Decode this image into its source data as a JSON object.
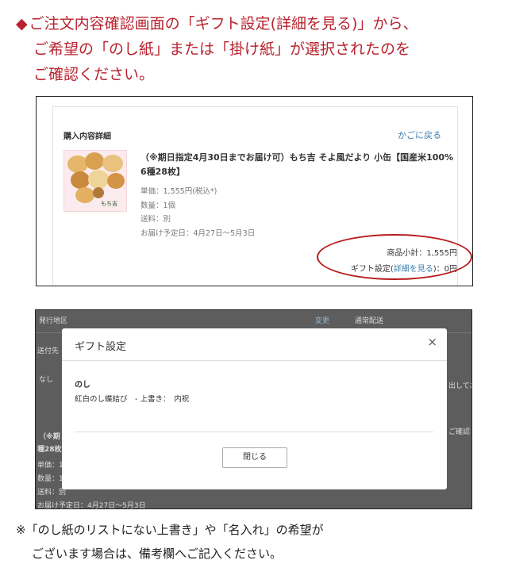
{
  "intro": {
    "bullet": "◆",
    "line1": "ご注文内容確認画面の「ギフト設定(詳細を見る)」から、",
    "line2": "ご希望の「のし紙」または「掛け紙」が選択されたのを",
    "line3": "ご確認ください。"
  },
  "order_screen": {
    "title": "購入内容詳細",
    "back_to_cart": "かごに戻る",
    "product_name": "（※期日指定4月30日までお届け可）もち吉 そよ風だより 小缶【国産米100% 6種28枚】",
    "image_brand": "もち吉",
    "unit_price": "単価：1,555円(税込*)",
    "quantity": "数量：1個",
    "shipping": "送料：別",
    "delivery": "お届け予定日：4月27日〜5月3日",
    "subtotal": "商品小計：1,555円",
    "gift_prefix": "ギフト設定(",
    "gift_link": "詳細を見る",
    "gift_suffix": ")：0円"
  },
  "gift_dialog": {
    "title": "ギフト設定",
    "close_icon": "×",
    "section_label": "のし",
    "section_value": "紅白のし蝶結び　- 上書き：　内祝",
    "close_button": "閉じる",
    "background": {
      "t1": "発行地区",
      "t2": "変更",
      "t3": "通常配送",
      "t4": "送付先",
      "t5": "なし",
      "t6": "出してお",
      "t7": "ご確認",
      "t8": "（※期",
      "t9": "種28枚",
      "t10": "単価：1",
      "t11": "数量：1",
      "t12": "送料：別",
      "t13": "お届け予定日：4月27日〜5月3日"
    }
  },
  "note": {
    "line1": "※「のし紙のリストにない上書き」や「名入れ」の希望が",
    "line2": "ございます場合は、備考欄へご記入ください。"
  }
}
